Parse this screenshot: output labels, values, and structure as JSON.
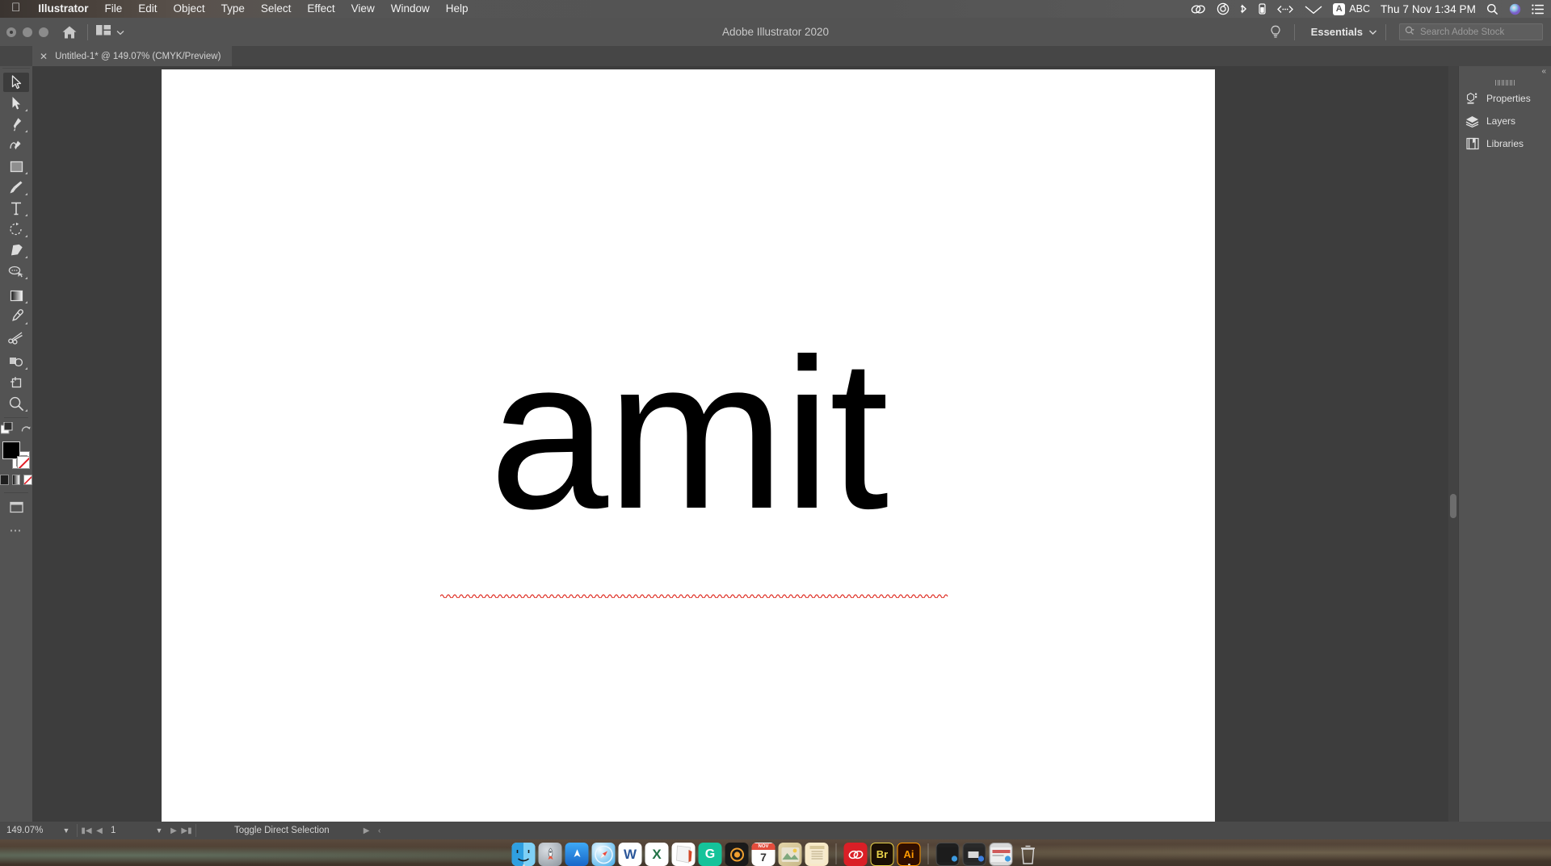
{
  "menubar": {
    "apple_icon": "apple-logo-icon",
    "items": [
      {
        "label": "Illustrator",
        "bold": true
      },
      {
        "label": "File",
        "bold": false
      },
      {
        "label": "Edit",
        "bold": false
      },
      {
        "label": "Object",
        "bold": false
      },
      {
        "label": "Type",
        "bold": false
      },
      {
        "label": "Select",
        "bold": false
      },
      {
        "label": "Effect",
        "bold": false
      },
      {
        "label": "View",
        "bold": false
      },
      {
        "label": "Window",
        "bold": false
      },
      {
        "label": "Help",
        "bold": false
      }
    ],
    "status_icons": [
      "creative-cloud-icon",
      "dropbox-icon",
      "bluetooth-icon",
      "battery-icon",
      "vpn-icon",
      "wifi-icon"
    ],
    "input_source": "ABC",
    "input_source_glyph": "A",
    "clock": "Thu 7 Nov  1:34 PM",
    "spotlight_icon": "search-icon",
    "siri_icon": "siri-icon",
    "control_center_icon": "control-center-icon"
  },
  "titlebar": {
    "app_title": "Adobe Illustrator 2020",
    "home_icon": "home-icon",
    "arrange_documents_icon": "arrange-documents-icon",
    "arrange_chevron_icon": "chevron-down-icon",
    "search_help_icon": "lightbulb-icon",
    "workspace": "Essentials",
    "workspace_chevron_icon": "chevron-down-icon",
    "stock_search_icon": "search-stock-icon",
    "stock_search_placeholder": "Search Adobe Stock",
    "stock_search_value": ""
  },
  "document_tab": {
    "close_icon": "close-icon",
    "title": "Untitled-1* @ 149.07% (CMYK/Preview)"
  },
  "toolbar": {
    "collapse_icon": "double-chevron-right-icon",
    "tools": [
      {
        "name": "selection-tool",
        "selected": true,
        "has_flyout": false
      },
      {
        "name": "direct-selection-tool",
        "selected": false,
        "has_flyout": true
      },
      {
        "name": "pen-tool",
        "selected": false,
        "has_flyout": true
      },
      {
        "name": "curvature-tool",
        "selected": false,
        "has_flyout": false
      },
      {
        "name": "rectangle-tool",
        "selected": false,
        "has_flyout": true
      },
      {
        "name": "paintbrush-tool",
        "selected": false,
        "has_flyout": true
      },
      {
        "name": "type-tool",
        "selected": false,
        "has_flyout": true
      },
      {
        "name": "rotate-tool",
        "selected": false,
        "has_flyout": true
      },
      {
        "name": "eraser-tool",
        "selected": false,
        "has_flyout": true
      },
      {
        "name": "shaper-tool",
        "selected": false,
        "has_flyout": true
      },
      {
        "name": "gradient-tool",
        "selected": false,
        "has_flyout": true
      },
      {
        "name": "eyedropper-tool",
        "selected": false,
        "has_flyout": true
      },
      {
        "name": "scissors-tool",
        "selected": false,
        "has_flyout": false
      },
      {
        "name": "artboard-tool",
        "selected": false,
        "has_flyout": true
      },
      {
        "name": "free-transform-tool",
        "selected": false,
        "has_flyout": false
      },
      {
        "name": "zoom-tool",
        "selected": false,
        "has_flyout": true
      }
    ],
    "fill_color": "#000000",
    "stroke_color": "#ffffff",
    "swap_fill_stroke_icon": "swap-fill-stroke-icon",
    "default_fill_stroke_icon": "default-fill-stroke-icon",
    "color_mode_icons": [
      "color-swatch-icon",
      "gradient-swatch-icon",
      "none-swatch-icon"
    ],
    "screen_mode_icon": "change-screen-mode-icon",
    "more_tools_icon": "more-tools-icon"
  },
  "canvas": {
    "artboard_background": "#ffffff",
    "artwork_text": "amit",
    "artwork_color": "#000000",
    "spellcheck_underline_color": "#e0352b",
    "vertical_scrollbar": "vertical-scrollbar",
    "horizontal_scrollbar": "horizontal-scrollbar"
  },
  "right_panel": {
    "collapse_icon": "double-chevron-left-icon",
    "items": [
      {
        "label": "Properties",
        "icon": "properties-icon"
      },
      {
        "label": "Layers",
        "icon": "layers-icon"
      },
      {
        "label": "Libraries",
        "icon": "libraries-icon"
      }
    ]
  },
  "statusbar": {
    "zoom_level": "149.07%",
    "zoom_chevron_icon": "chevron-down-icon",
    "first_page_icon": "first-artboard-icon",
    "prev_page_icon": "prev-artboard-icon",
    "page_number": "1",
    "page_chevron_icon": "chevron-down-icon",
    "next_page_icon": "next-artboard-icon",
    "last_page_icon": "last-artboard-icon",
    "current_tool_status": "Toggle Direct Selection",
    "status_menu_icon": "status-menu-icon",
    "resize_icon": "resize-grip-icon"
  },
  "dock": {
    "items": [
      {
        "name": "finder",
        "label": "Finder",
        "color": "#2d9ce8",
        "glyph": "☺",
        "running": true
      },
      {
        "name": "launchpad",
        "label": "Launchpad",
        "color": "#9aa3ad",
        "glyph": "●",
        "running": false
      },
      {
        "name": "appstore",
        "label": "App Store",
        "color": "#1e7fe0",
        "glyph": "A",
        "running": false
      },
      {
        "name": "safari",
        "label": "Safari",
        "color": "#1da1f2",
        "glyph": "✦",
        "running": false
      },
      {
        "name": "word",
        "label": "Microsoft Word",
        "color": "#2b579a",
        "glyph": "W",
        "running": false
      },
      {
        "name": "excel",
        "label": "Microsoft Excel",
        "color": "#217346",
        "glyph": "X",
        "running": false
      },
      {
        "name": "powerpoint",
        "label": "PowerPoint",
        "color": "#d24726",
        "glyph": "P",
        "running": false
      },
      {
        "name": "grammarly",
        "label": "Grammarly",
        "color": "#15c39a",
        "glyph": "G",
        "running": false
      },
      {
        "name": "podcasts",
        "label": "Podcasts",
        "color": "#111111",
        "glyph": "◉",
        "running": false
      },
      {
        "name": "calendar",
        "label": "Calendar",
        "color": "#ffffff",
        "glyph": "7",
        "running": false
      },
      {
        "name": "photos",
        "label": "Photos",
        "color": "#e8c87a",
        "glyph": "❀",
        "running": false
      },
      {
        "name": "notes",
        "label": "Notes",
        "color": "#f5c14e",
        "glyph": "≡",
        "running": false
      },
      {
        "name": "creative-cloud",
        "label": "Creative Cloud",
        "color": "#da1f26",
        "glyph": "∞",
        "running": false
      },
      {
        "name": "bridge",
        "label": "Adobe Bridge",
        "color": "#1a0f05",
        "glyph": "Br",
        "running": false
      },
      {
        "name": "illustrator",
        "label": "Adobe Illustrator",
        "color": "#310f00",
        "glyph": "Ai",
        "running": true
      }
    ],
    "minimized": [
      {
        "name": "minimized-window-1",
        "badge": "finder-badge"
      },
      {
        "name": "minimized-window-2",
        "badge": "mail-badge"
      },
      {
        "name": "minimized-window-3",
        "badge": "safari-badge"
      }
    ],
    "trash_icon": "trash-icon",
    "calendar_month": "NOV",
    "calendar_day": "7"
  }
}
